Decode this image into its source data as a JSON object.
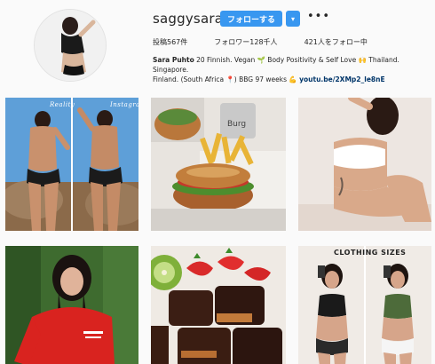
{
  "profile": {
    "username": "saggysara",
    "follow_label": "フォローする",
    "dropdown_icon": "caret-down-icon",
    "more_icon": "ellipsis-icon",
    "more_label": "•••",
    "dropdown_label": "▾",
    "stats": {
      "posts": "投稿567件",
      "followers": "フォロワー128千人",
      "following": "421人をフォロー中"
    },
    "bio": {
      "name": "Sara Puhto",
      "line1": " 20 Finnish. Vegan 🌱 Body Positivity & Self Love 🙌 Thailand. Singapore.",
      "line2": "Finland. (South Africa 📍) BBG 97 weeks 💪 ",
      "link": "youtu.be/2XMp2_le8nE"
    }
  },
  "posts": [
    {
      "label_left": "Reality",
      "label_right": "Instagram"
    },
    {
      "label": ""
    },
    {
      "label": ""
    },
    {
      "label": ""
    },
    {
      "label": ""
    },
    {
      "label": "CLOTHING SIZES"
    }
  ],
  "colors": {
    "follow_blue": "#3897f0",
    "link_blue": "#003569",
    "background": "#fafafa"
  }
}
